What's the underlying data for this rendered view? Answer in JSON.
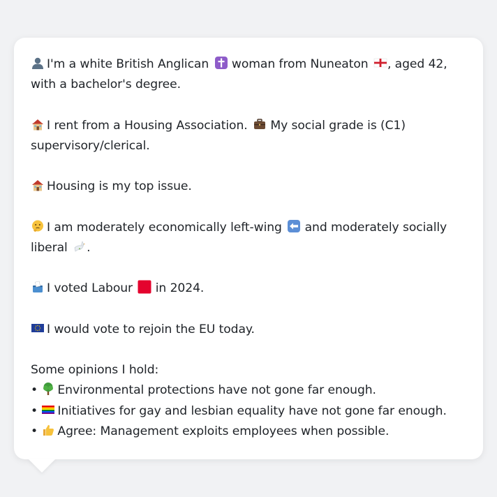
{
  "profile": {
    "identity": {
      "icon": "person-silhouette-icon",
      "text_1": "I'm a white British Anglican",
      "religion_icon": "latin-cross-icon",
      "text_2": "woman from Nuneaton",
      "flag_icon": "england-flag-icon",
      "text_3": ", aged 42, with a bachelor's degree."
    },
    "housing": {
      "icon": "house-icon",
      "text_1": "I rent from a Housing Association.",
      "work_icon": "briefcase-icon",
      "text_2": "My social grade is (C1) supervisory/clerical."
    },
    "top_issue": {
      "icon": "house-icon",
      "text": "Housing is my top issue."
    },
    "ideology": {
      "icon": "thinking-face-icon",
      "text_1": "I am moderately economically left-wing",
      "left_icon": "left-arrow-icon",
      "text_2": "and moderately socially liberal",
      "liberal_icon": "dove-icon",
      "text_3": "."
    },
    "vote": {
      "icon": "ballot-box-icon",
      "text_1": "I voted Labour",
      "party_icon": "red-square-icon",
      "text_2": "in 2024."
    },
    "eu": {
      "icon": "eu-flag-icon",
      "text": "I would vote to rejoin the EU today."
    },
    "opinions": {
      "heading": "Some opinions I hold:",
      "bullet": "•",
      "items": [
        {
          "icon": "deciduous-tree-icon",
          "text": "Environmental protections have not gone far enough."
        },
        {
          "icon": "rainbow-flag-icon",
          "text": "Initiatives for gay and lesbian equality have not gone far enough."
        },
        {
          "icon": "thumbs-up-icon",
          "text": "Agree: Management exploits employees when possible."
        }
      ]
    }
  },
  "colors": {
    "background": "#f1f2f4",
    "bubble": "#ffffff",
    "text": "#1f2328",
    "labour_red": "#e4032e"
  }
}
